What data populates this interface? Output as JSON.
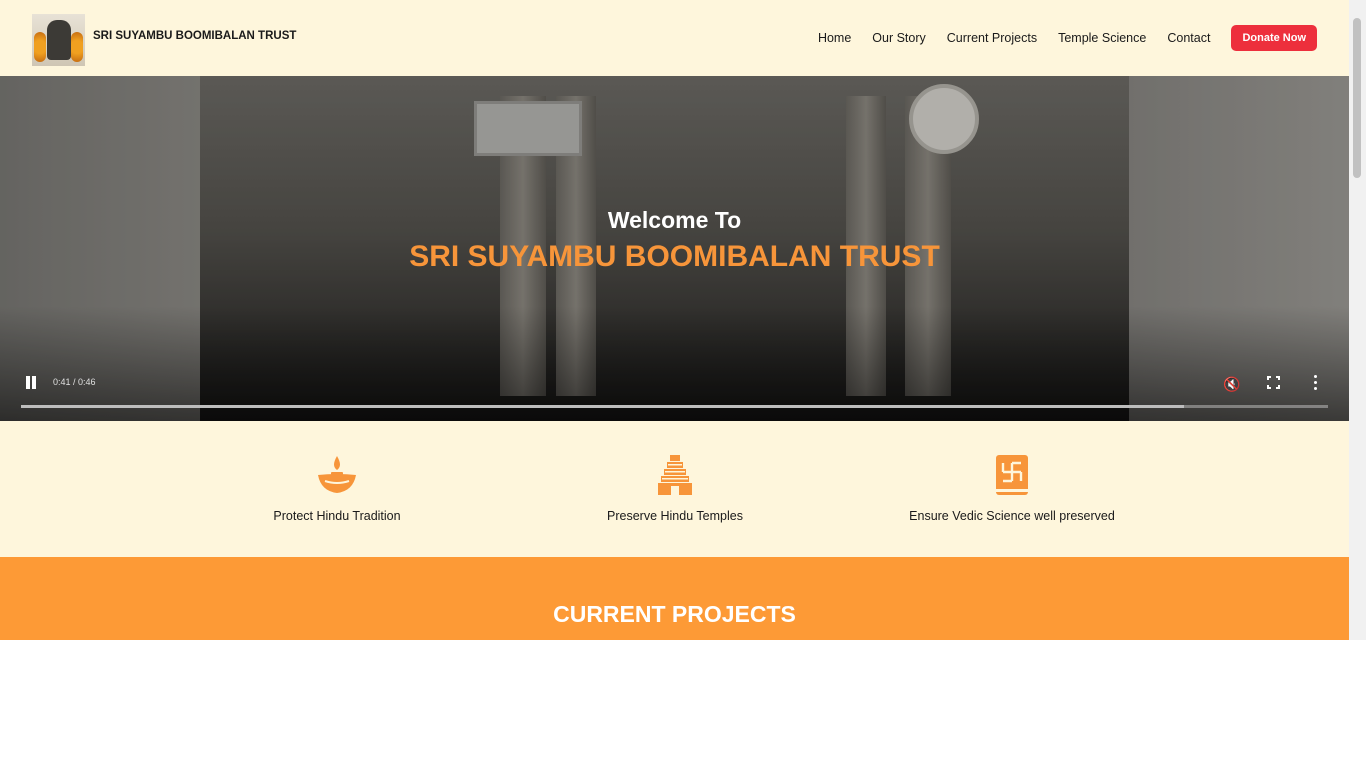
{
  "header": {
    "brand": "SRI SUYAMBU BOOMIBALAN TRUST",
    "nav": [
      "Home",
      "Our Story",
      "Current Projects",
      "Temple Science",
      "Contact"
    ],
    "donate_label": "Donate Now"
  },
  "hero": {
    "welcome": "Welcome To",
    "title": "SRI SUYAMBU BOOMIBALAN TRUST",
    "video": {
      "time": "0:41 / 0:46",
      "progress": 0.89,
      "state": "playing",
      "muted": true
    }
  },
  "features": [
    {
      "icon": "diya-lamp-icon",
      "label": "Protect Hindu Tradition"
    },
    {
      "icon": "temple-gopuram-icon",
      "label": "Preserve Hindu Temples"
    },
    {
      "icon": "vedic-book-icon",
      "label": "Ensure Vedic Science well preserved"
    }
  ],
  "projects": {
    "heading": "CURRENT PROJECTS"
  },
  "colors": {
    "header_bg": "#fef6dc",
    "accent_orange": "#f7953a",
    "projects_bg": "#fd9a36",
    "donate_red": "#ed2f3c"
  }
}
